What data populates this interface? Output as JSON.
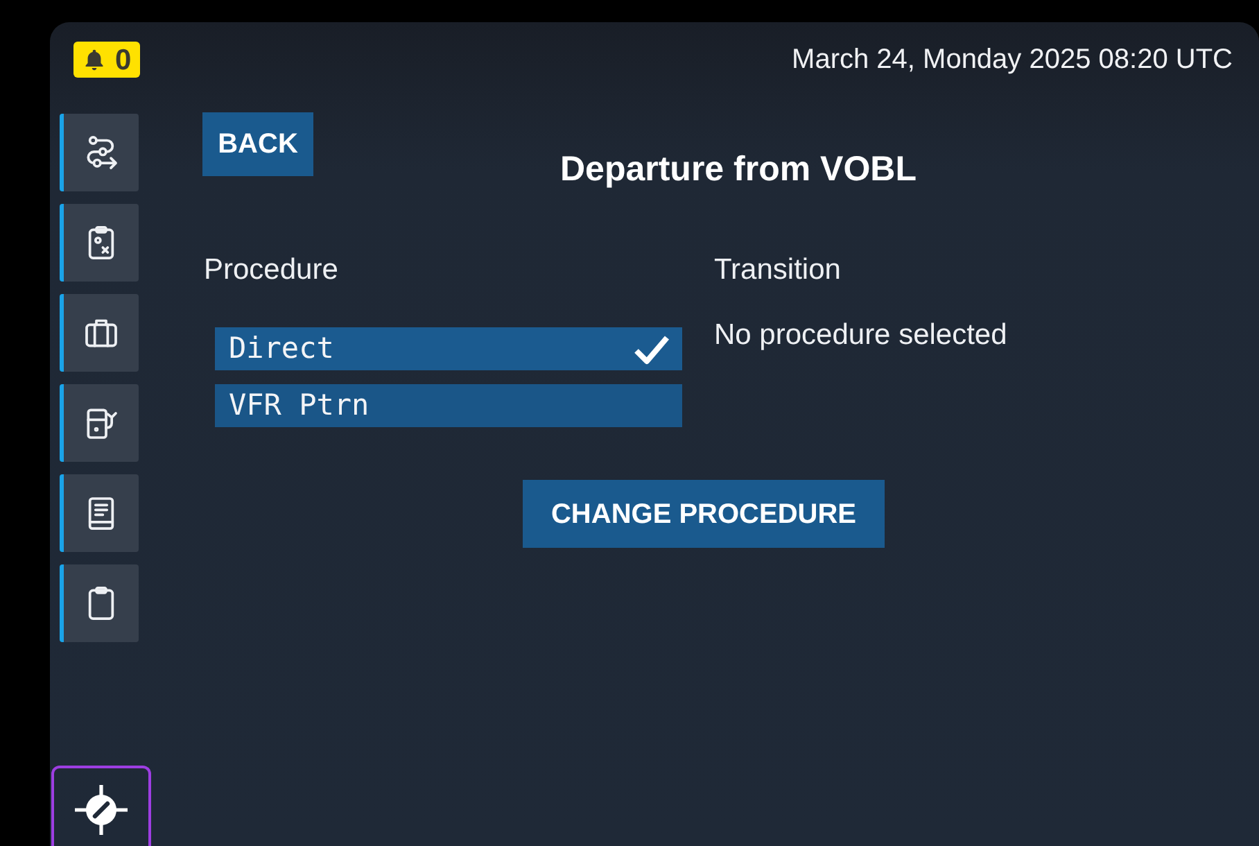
{
  "status_bar": {
    "alert_count": "0",
    "datetime": "March 24, Monday 2025 08:20 UTC"
  },
  "back_button": "BACK",
  "title": "Departure from VOBL",
  "procedure": {
    "label": "Procedure",
    "items": [
      {
        "label": "Direct",
        "selected": true
      },
      {
        "label": "VFR Ptrn",
        "selected": false
      }
    ]
  },
  "transition": {
    "label": "Transition",
    "value": "No procedure selected"
  },
  "action_button": "CHANGE PROCEDURE"
}
